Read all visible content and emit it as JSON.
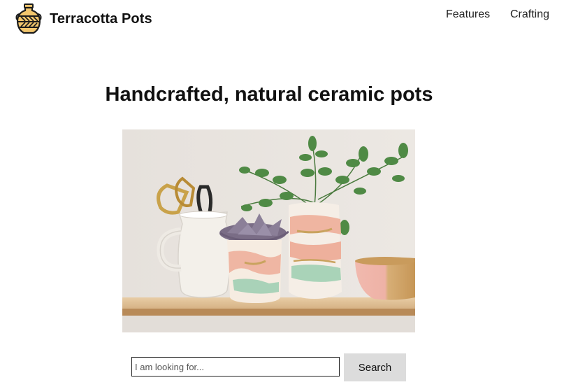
{
  "header": {
    "brand": "Terracotta Pots",
    "logo_icon": "amphora-icon",
    "nav": [
      {
        "label": "Features"
      },
      {
        "label": "Crafting"
      }
    ]
  },
  "hero": {
    "title": "Handcrafted, natural ceramic pots",
    "image_icon": "ceramic-pots-photo"
  },
  "search": {
    "placeholder": "I am looking for...",
    "value": "",
    "button_label": "Search"
  },
  "colors": {
    "logo_gold": "#f2c66d",
    "logo_outline": "#1c1c1c",
    "button_bg": "#dcdcdc"
  }
}
